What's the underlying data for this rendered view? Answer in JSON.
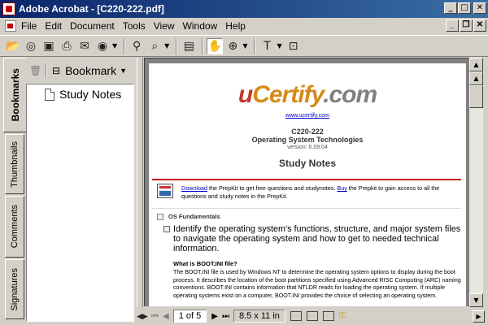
{
  "window": {
    "title": "Adobe Acrobat - [C220-222.pdf]",
    "minimize": "_",
    "maximize": "□",
    "close": "✕"
  },
  "menu": [
    "File",
    "Edit",
    "Document",
    "Tools",
    "View",
    "Window",
    "Help"
  ],
  "nav_tabs": [
    "Bookmarks",
    "Thumbnails",
    "Comments",
    "Signatures"
  ],
  "bookmark_panel": {
    "label": "Bookmark",
    "items": [
      "Study Notes"
    ]
  },
  "document": {
    "logo": {
      "u": "u",
      "certify": "Certify",
      "dotcom": ".com"
    },
    "url": "www.ucertify.com",
    "code": "C220-222",
    "course": "Operating System Technologies",
    "version": "version: 6.09.04",
    "section_title": "Study Notes",
    "download_link": "Download",
    "download_text_1": " the PrepKit to get free questions and studynotes. ",
    "buy_link": "Buy",
    "download_text_2": " the Prepkit to gain access to all the questions and study notes in the PrepKit.",
    "os_heading": "OS Fundamentals",
    "objective": "Identify the operating system's functions, structure, and major system files to navigate the operating system and how to get to needed technical information.",
    "question": "What is BOOT.INI file?",
    "answer": "The BOOT.INI file is used by Windows NT to determine the operating system options to display during the boot process. It describes the location of the boot partitions specified using Advanced RISC Computing (ARC) naming conventions. BOOT.INI contains information that NTLDR reads for loading the operating system. If multiple operating systems exist on a computer, BOOT.INI provides the choice of selecting an operating system."
  },
  "status": {
    "page": "1 of 5",
    "size": "8.5 x 11 in"
  }
}
